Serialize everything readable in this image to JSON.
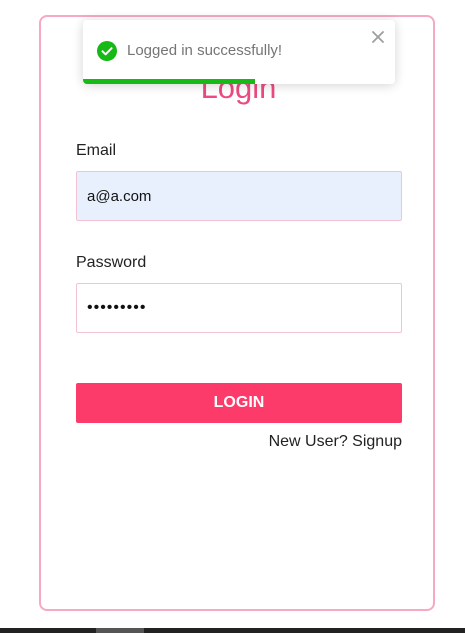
{
  "login_form": {
    "title": "Login",
    "email_label": "Email",
    "email_value": "a@a.com",
    "password_label": "Password",
    "password_value": "•••••••••",
    "submit_label": "LOGIN",
    "signup_text": "New User? Signup"
  },
  "toast": {
    "message": "Logged in successfully!",
    "icon": "check-circle-icon",
    "progress": 0.55
  },
  "colors": {
    "accent": "#fd3b6b",
    "title": "#ec4b80",
    "card_border": "#f7a8c4",
    "success": "#16b916",
    "autofill_bg": "#e8f0fe"
  }
}
